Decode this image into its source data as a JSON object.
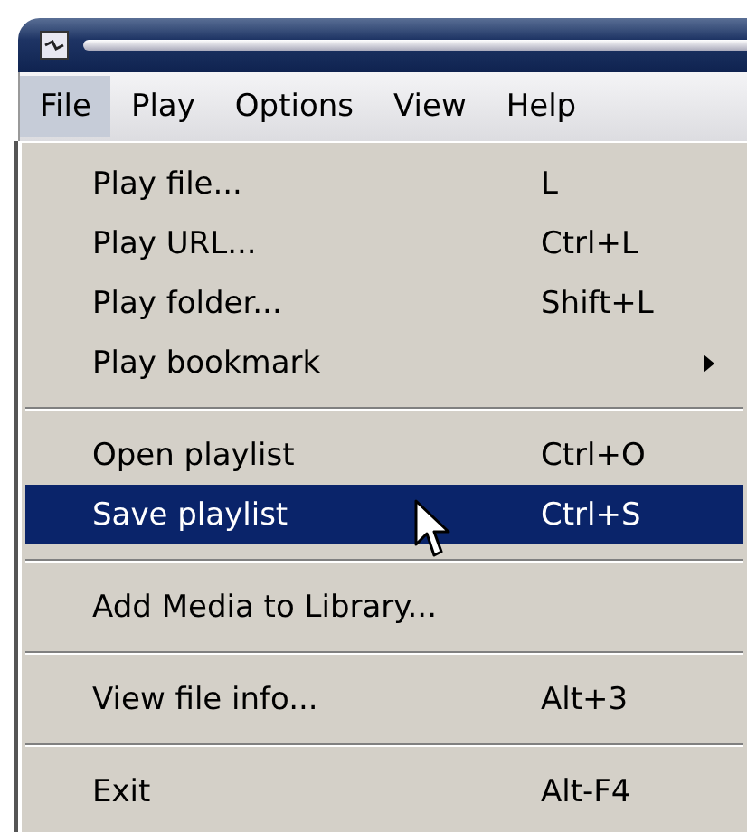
{
  "menu_bar": [
    {
      "label": "File",
      "selected": true
    },
    {
      "label": "Play",
      "selected": false
    },
    {
      "label": "Options",
      "selected": false
    },
    {
      "label": "View",
      "selected": false
    },
    {
      "label": "Help",
      "selected": false
    }
  ],
  "menu": [
    {
      "kind": "item",
      "label": "Play file...",
      "shortcut": "L",
      "selected": false
    },
    {
      "kind": "item",
      "label": "Play URL...",
      "shortcut": "Ctrl+L",
      "selected": false
    },
    {
      "kind": "item",
      "label": "Play folder...",
      "shortcut": "Shift+L",
      "selected": false
    },
    {
      "kind": "submenu",
      "label": "Play bookmark",
      "selected": false
    },
    {
      "kind": "separator"
    },
    {
      "kind": "item",
      "label": "Open playlist",
      "shortcut": "Ctrl+O",
      "selected": false
    },
    {
      "kind": "item",
      "label": "Save playlist",
      "shortcut": "Ctrl+S",
      "selected": true
    },
    {
      "kind": "separator"
    },
    {
      "kind": "item",
      "label": "Add Media to Library...",
      "selected": false
    },
    {
      "kind": "separator"
    },
    {
      "kind": "item",
      "label": "View file info...",
      "shortcut": "Alt+3",
      "selected": false
    },
    {
      "kind": "separator"
    },
    {
      "kind": "item",
      "label": "Exit",
      "shortcut": "Alt-F4",
      "selected": false
    }
  ]
}
